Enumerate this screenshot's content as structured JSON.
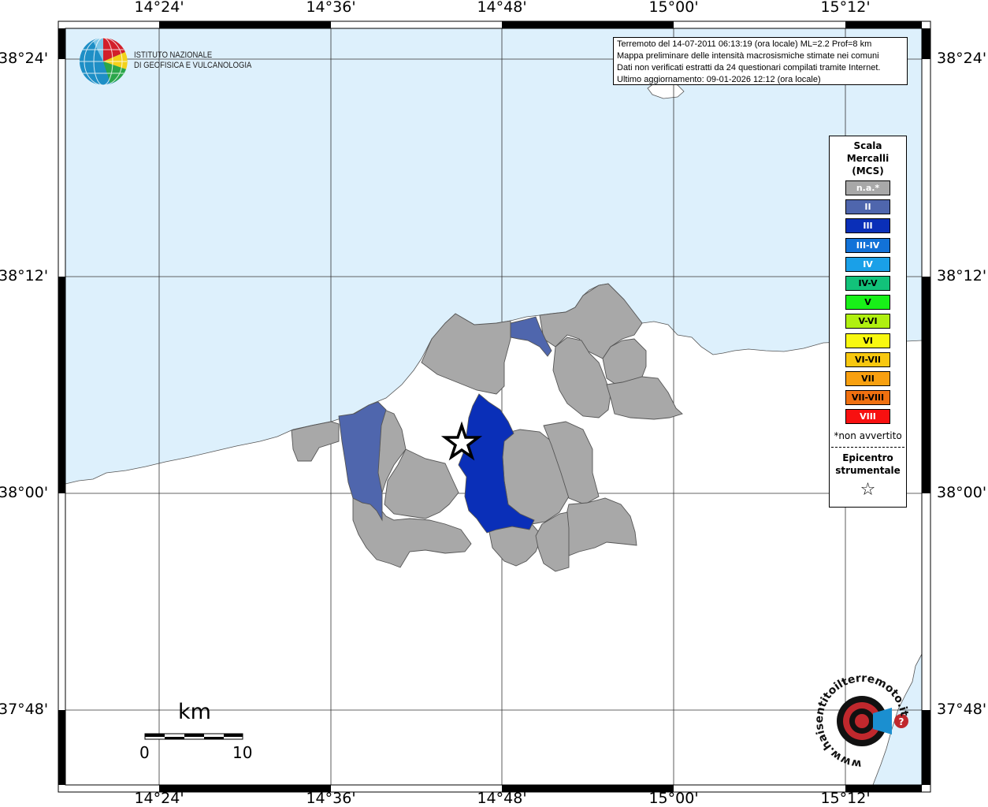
{
  "map": {
    "lon_ticks": [
      "14°24'",
      "14°36'",
      "14°48'",
      "15°00'",
      "15°12'"
    ],
    "lat_ticks": [
      "38°24'",
      "38°12'",
      "38°00'",
      "37°48'"
    ],
    "colors": {
      "sea": "#ddf0fc",
      "land": "#ffffff",
      "na": "#a8a8a8",
      "II": "#4f66ad",
      "III": "#0a2fb8"
    }
  },
  "info": {
    "line1": "Terremoto del 14-07-2011 06:13:19 (ora locale) ML=2.2 Prof=8 km",
    "line2": "Mappa preliminare delle intensità macrosismiche stimate nei comuni",
    "line3": "Dati non verificati estratti da 24 questionari compilati tramite Internet.",
    "line4": "Ultimo aggiornamento: 09-01-2026 12:12 (ora locale)"
  },
  "logo": {
    "line1": "ISTITUTO NAZIONALE",
    "line2": "DI GEOFISICA E VULCANOLOGIA",
    "badge_text": "www.haisentitoilterremoto.it"
  },
  "legend": {
    "title1": "Scala",
    "title2": "Mercalli",
    "title3": "(MCS)",
    "items": [
      {
        "label": "n.a.*",
        "color": "#a8a8a8",
        "text_color": "#ffffff"
      },
      {
        "label": "II",
        "color": "#4f66ad",
        "text_color": "#ffffff"
      },
      {
        "label": "III",
        "color": "#0a2fb8",
        "text_color": "#ffffff"
      },
      {
        "label": "III-IV",
        "color": "#1272d8",
        "text_color": "#ffffff"
      },
      {
        "label": "IV",
        "color": "#1aa0e8",
        "text_color": "#ffffff"
      },
      {
        "label": "IV-V",
        "color": "#12c27a",
        "text_color": "#000000"
      },
      {
        "label": "V",
        "color": "#18f018",
        "text_color": "#000000"
      },
      {
        "label": "V-VI",
        "color": "#b0f010",
        "text_color": "#000000"
      },
      {
        "label": "VI",
        "color": "#f8f810",
        "text_color": "#000000"
      },
      {
        "label": "VI-VII",
        "color": "#f8c810",
        "text_color": "#000000"
      },
      {
        "label": "VII",
        "color": "#f8a010",
        "text_color": "#000000"
      },
      {
        "label": "VII-VIII",
        "color": "#f07010",
        "text_color": "#000000"
      },
      {
        "label": "VIII",
        "color": "#f81010",
        "text_color": "#ffffff"
      }
    ],
    "note": "*non avvertito",
    "epicenter1": "Epicentro",
    "epicenter2": "strumentale",
    "star": "☆"
  },
  "scalebar": {
    "unit": "km",
    "min": "0",
    "max": "10"
  }
}
